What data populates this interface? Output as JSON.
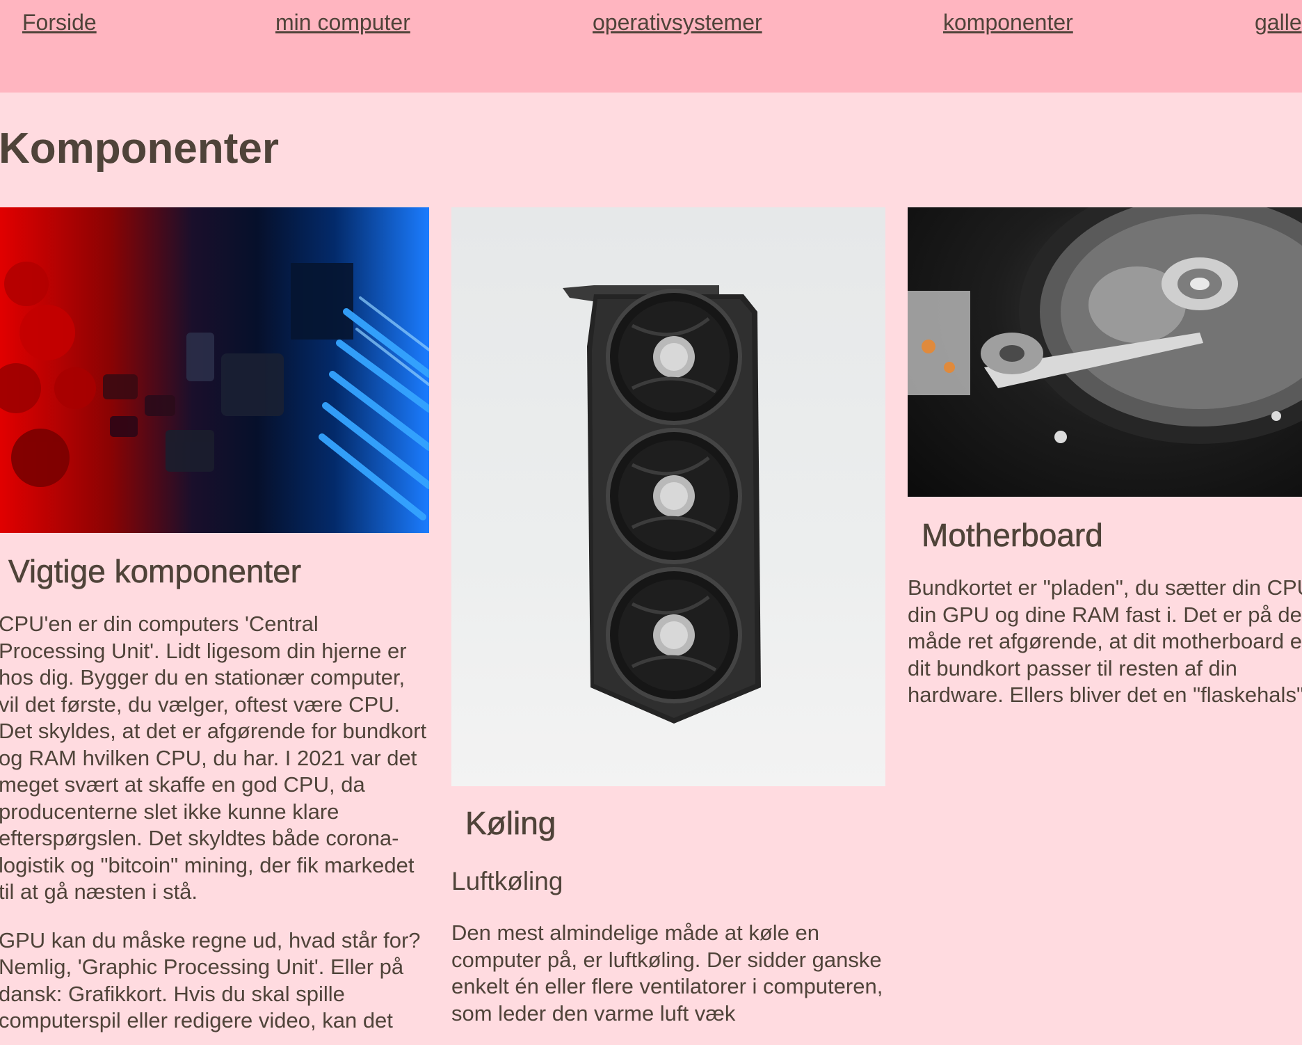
{
  "nav": {
    "items": [
      "Forside",
      "min computer",
      "operativsystemer",
      "komponenter",
      "galle"
    ]
  },
  "page": {
    "title": "Komponenter"
  },
  "columns": [
    {
      "heading": "Vigtige komponenter",
      "image_icon": "circuit-board-image",
      "paragraphs": [
        "CPU'en er din computers 'Central Processing Unit'. Lidt ligesom din hjerne er hos dig. Bygger du en stationær computer, vil det første, du vælger, oftest være CPU. Det skyldes, at det er afgørende for bundkort og RAM hvilken CPU, du har. I 2021 var det meget svært at skaffe en god CPU, da producenterne slet ikke kunne klare efterspørgslen. Det skyldtes både corona-logistik og \"bitcoin\" mining, der fik markedet til at gå næsten i stå.",
        "GPU kan du måske regne ud, hvad står for? Nemlig, 'Graphic Processing Unit'. Eller på dansk: Grafikkort. Hvis du skal spille computerspil eller redigere video, kan det"
      ]
    },
    {
      "heading": "Køling",
      "image_icon": "graphics-card-image",
      "subheading": "Luftkøling",
      "paragraphs": [
        "Den mest almindelige måde at køle en computer på, er luftkøling. Der sidder ganske enkelt én eller flere ventilatorer i computeren, som leder den varme luft væk"
      ]
    },
    {
      "heading": "Motherboard",
      "image_icon": "hard-drive-image",
      "paragraphs": [
        "Bundkortet er \"pladen\", du sætter din CPU, din GPU og dine RAM fast i. Det er på den måde ret afgørende, at dit motherboard eller dit bundkort passer til resten af din hardware. Ellers bliver det en \"flaskehals\"."
      ]
    }
  ]
}
